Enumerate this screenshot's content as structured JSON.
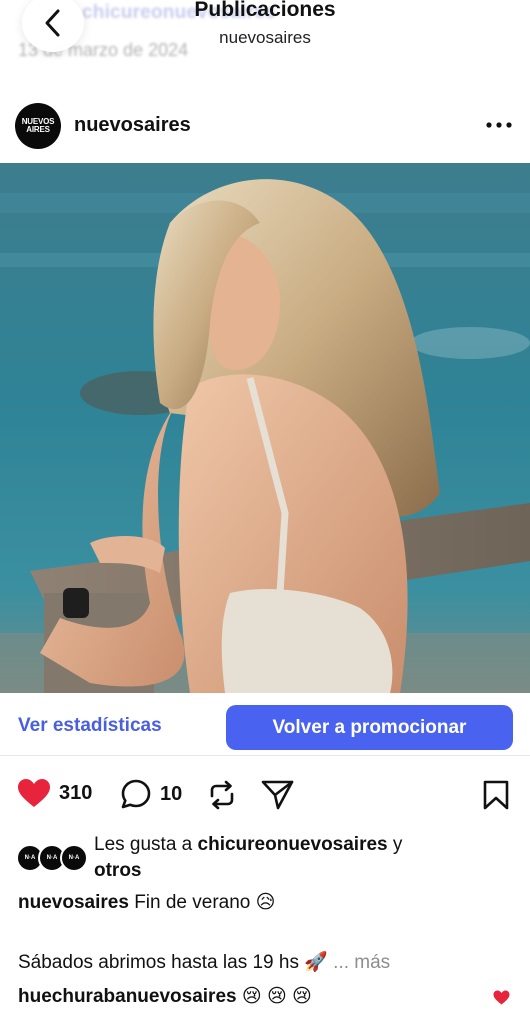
{
  "header": {
    "title": "Publicaciones",
    "subtitle": "nuevosaires",
    "behind_username": "chicureonuevosaires",
    "behind_date": "13 de marzo de 2024"
  },
  "post": {
    "username": "nuevosaires",
    "avatar_text": "NUEVOS AIRES",
    "more_icon": "more-horizontal-icon"
  },
  "promo": {
    "stats_label": "Ver estadísticas",
    "promote_label": "Volver a promocionar"
  },
  "actions": {
    "likes_count": "310",
    "comments_count": "10",
    "icons": [
      "heart-filled-icon",
      "comment-icon",
      "repost-icon",
      "share-icon",
      "bookmark-icon"
    ]
  },
  "likes": {
    "prefix": "Les gusta a ",
    "user": "chicureonuevosaires",
    "suffix": " y",
    "others": "otros"
  },
  "caption": {
    "user": "nuevosaires",
    "text": "Fin de verano 😥",
    "line2": "Sábados abrimos hasta las 19 hs 🚀",
    "more": "... más"
  },
  "comment": {
    "user": "huechurabanuevosaires",
    "text": "😢 😢 😢"
  },
  "colors": {
    "accent": "#4a62f0",
    "link": "#4a5fe0",
    "like": "#e8243c"
  }
}
